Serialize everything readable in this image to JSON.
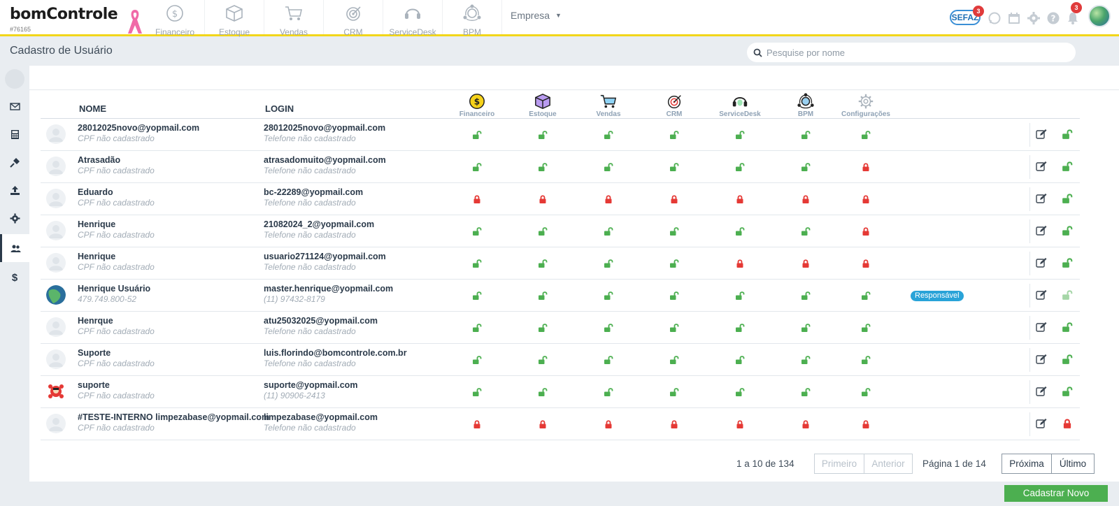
{
  "app": {
    "logo_text": "bomControle",
    "account_code": "#76165"
  },
  "top_modules": [
    {
      "label": "Financeiro",
      "icon": "dollar-circle-icon"
    },
    {
      "label": "Estoque",
      "icon": "box-icon"
    },
    {
      "label": "Vendas",
      "icon": "cart-icon"
    },
    {
      "label": "CRM",
      "icon": "target-icon"
    },
    {
      "label": "ServiceDesk",
      "icon": "headset-icon"
    },
    {
      "label": "BPM",
      "icon": "network-icon"
    }
  ],
  "empresa_label": "Empresa",
  "top_right": {
    "sefaz_label": "SEFAZ",
    "sefaz_badge": "3",
    "notifications_badge": "3"
  },
  "page_title": "Cadastro de Usuário",
  "search": {
    "placeholder": "Pesquise por nome",
    "value": ""
  },
  "table": {
    "col_nome": "NOME",
    "col_login": "LOGIN",
    "module_headers": [
      "Financeiro",
      "Estoque",
      "Vendas",
      "CRM",
      "ServiceDesk",
      "BPM",
      "Configurações"
    ],
    "rows": [
      {
        "name": "28012025novo@yopmail.com",
        "cpf": "CPF não cadastrado",
        "login": "28012025novo@yopmail.com",
        "phone": "Telefone não cadastrado",
        "perms": [
          1,
          1,
          1,
          1,
          1,
          1,
          1
        ],
        "avatar": "default",
        "tag": "",
        "user_lock": 1
      },
      {
        "name": "Atrasadão",
        "cpf": "CPF não cadastrado",
        "login": "atrasadomuito@yopmail.com",
        "phone": "Telefone não cadastrado",
        "perms": [
          1,
          1,
          1,
          1,
          1,
          1,
          0
        ],
        "avatar": "default",
        "tag": "",
        "user_lock": 1
      },
      {
        "name": "Eduardo",
        "cpf": "CPF não cadastrado",
        "login": "bc-22289@yopmail.com",
        "phone": "Telefone não cadastrado",
        "perms": [
          0,
          0,
          0,
          0,
          0,
          0,
          0
        ],
        "avatar": "default",
        "tag": "",
        "user_lock": 1
      },
      {
        "name": "Henrique",
        "cpf": "CPF não cadastrado",
        "login": "21082024_2@yopmail.com",
        "phone": "Telefone não cadastrado",
        "perms": [
          1,
          1,
          1,
          1,
          1,
          1,
          0
        ],
        "avatar": "default",
        "tag": "",
        "user_lock": 1
      },
      {
        "name": "Henrique",
        "cpf": "CPF não cadastrado",
        "login": "usuario271124@yopmail.com",
        "phone": "Telefone não cadastrado",
        "perms": [
          1,
          1,
          1,
          1,
          0,
          0,
          0
        ],
        "avatar": "default",
        "tag": "",
        "user_lock": 1
      },
      {
        "name": "Henrique Usuário",
        "cpf": "479.749.800-52",
        "login": "master.henrique@yopmail.com",
        "phone": "(11) 97432-8179",
        "perms": [
          1,
          1,
          1,
          1,
          1,
          1,
          1
        ],
        "avatar": "globe",
        "tag": "Responsável",
        "user_lock": 2
      },
      {
        "name": "Henrque",
        "cpf": "CPF não cadastrado",
        "login": "atu25032025@yopmail.com",
        "phone": "Telefone não cadastrado",
        "perms": [
          1,
          1,
          1,
          1,
          1,
          1,
          1
        ],
        "avatar": "default",
        "tag": "",
        "user_lock": 1
      },
      {
        "name": "Suporte",
        "cpf": "CPF não cadastrado",
        "login": "luis.florindo@bomcontrole.com.br",
        "phone": "Telefone não cadastrado",
        "perms": [
          1,
          1,
          1,
          1,
          1,
          1,
          1
        ],
        "avatar": "default",
        "tag": "",
        "user_lock": 1
      },
      {
        "name": "suporte",
        "cpf": "CPF não cadastrado",
        "login": "suporte@yopmail.com",
        "phone": "(11) 90906-2413",
        "perms": [
          1,
          1,
          1,
          1,
          1,
          1,
          1
        ],
        "avatar": "mascot",
        "tag": "",
        "user_lock": 1
      },
      {
        "name": "#TESTE-INTERNO limpezabase@yopmail.com",
        "cpf": "CPF não cadastrado",
        "login": "limpezabase@yopmail.com",
        "phone": "Telefone não cadastrado",
        "perms": [
          0,
          0,
          0,
          0,
          0,
          0,
          0
        ],
        "avatar": "default",
        "tag": "",
        "user_lock": 0
      }
    ]
  },
  "pagination": {
    "count": "1 a 10 de 134",
    "first": "Primeiro",
    "prev": "Anterior",
    "page": "Página 1 de 14",
    "next": "Próxima",
    "last": "Último"
  },
  "cadastrar_label": "Cadastrar Novo",
  "colors": {
    "accent_yellow": "#f2d61a",
    "unlocked_green": "#4caf50",
    "locked_red": "#e53935",
    "tag_blue": "#29a3d8"
  }
}
